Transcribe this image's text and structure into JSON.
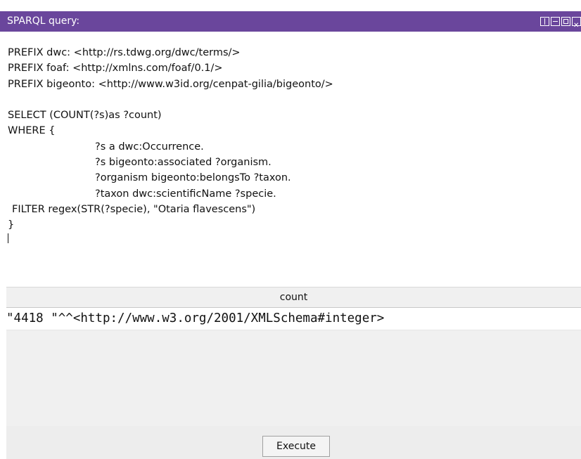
{
  "window": {
    "title": "SPARQL query:",
    "controls": [
      "tile-icon",
      "minimize-icon",
      "maximize-icon",
      "close-icon"
    ],
    "title_bg_color": "#6a469c"
  },
  "query": {
    "lines": [
      "PREFIX dwc: <http://rs.tdwg.org/dwc/terms/>",
      "PREFIX foaf: <http://xmlns.com/foaf/0.1/>",
      "PREFIX bigeonto: <http://www.w3id.org/cenpat-gilia/bigeonto/>",
      "",
      "SELECT (COUNT(?s)as ?count)",
      "WHERE {",
      "?s a dwc:Occurrence.",
      "?s bigeonto:associated ?organism.",
      "?organism bigeonto:belongsTo ?taxon.",
      "?taxon dwc:scientificName ?specie.",
      "FILTER regex(STR(?specie), \"Otaria flavescens\")",
      "}"
    ]
  },
  "results": {
    "columns": [
      "count"
    ],
    "rows": [
      [
        "\"4418 \"^^<http://www.w3.org/2001/XMLSchema#integer>"
      ]
    ]
  },
  "actions": {
    "execute_label": "Execute"
  }
}
